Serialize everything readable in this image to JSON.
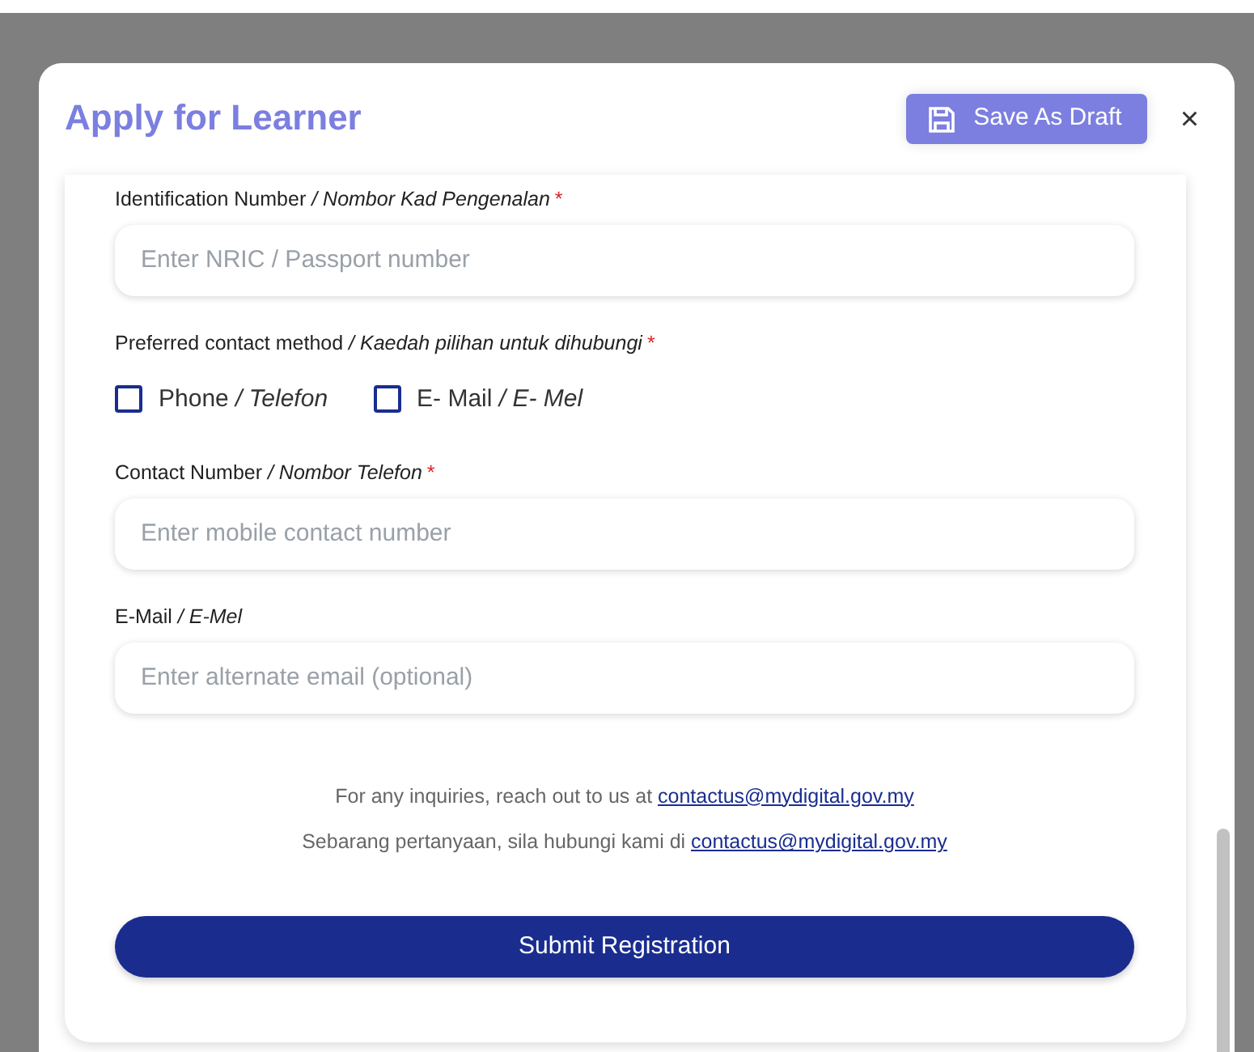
{
  "modal": {
    "title": "Apply for Learner",
    "save_button": "Save As Draft",
    "close": "×"
  },
  "form": [
    {
      "kind": "input",
      "label": "Identification Number */ Nombor Kad Pengenalan*",
      "required_mark": "*",
      "placeholder": "Enter NRIC / Passport number"
    },
    {
      "kind": "checkgroup",
      "label": "Preferred contact method */ Kaedah pilihan untuk dihubungi*",
      "required_mark": "*",
      "options": [
        {
          "label": "Phone */ Telefon*",
          "checked": false
        },
        {
          "label": "E- Mail */ E- Mel*",
          "checked": false
        }
      ]
    },
    {
      "kind": "input",
      "label": "Contact Number */ Nombor Telefon*",
      "required_mark": "*",
      "placeholder": "Enter mobile contact number"
    },
    {
      "kind": "input",
      "label": "E-Mail */ E-Mel*",
      "placeholder": "Enter alternate email (optional)"
    }
  ],
  "contact_lines": [
    {
      "text": "For any inquiries, reach out to us at",
      "link": "contactus@mydigital.gov.my"
    },
    {
      "text": "Sebarang pertanyaan, sila hubungi kami di",
      "link": "contactus@mydigital.gov.my"
    }
  ],
  "submit_button": "Submit Registration"
}
